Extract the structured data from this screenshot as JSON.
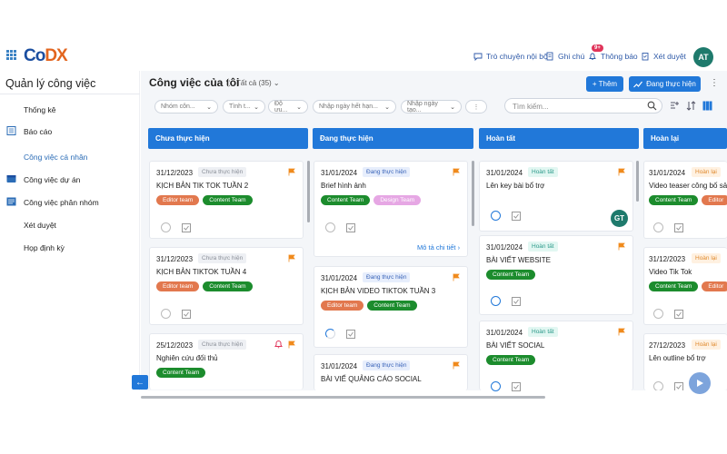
{
  "app": {
    "logo_part1": "Co",
    "logo_part2": "DX"
  },
  "topbar": {
    "chat_label": "Trò chuyện nội bộ",
    "notes_label": "Ghi chú",
    "notify_label": "Thông báo",
    "notify_badge": "9+",
    "approve_label": "Xét duyệt",
    "avatar_initials": "AT"
  },
  "sidebar": {
    "title": "Quản lý công việc",
    "items": [
      {
        "label": "Thống kê",
        "active": false,
        "icon": "none"
      },
      {
        "label": "Báo cáo",
        "active": false,
        "icon": "report-icon"
      },
      {
        "label": "Công việc cá nhân",
        "active": true,
        "icon": "none"
      },
      {
        "label": "Công việc dự án",
        "active": false,
        "icon": "project-icon"
      },
      {
        "label": "Công việc phân nhóm",
        "active": false,
        "icon": "group-icon"
      },
      {
        "label": "Xét duyệt",
        "active": false,
        "icon": "none"
      },
      {
        "label": "Họp định kỳ",
        "active": false,
        "icon": "none"
      }
    ]
  },
  "header": {
    "title": "Công việc của tôi",
    "filter_all": "Tất cả (35)",
    "add_button": "+ Thêm",
    "status_button": "Đang thực hiện",
    "kebab": "⋮"
  },
  "filters": {
    "pills": [
      "Nhóm côn...",
      "Tình t...",
      "Độ ưu...",
      "Nhập ngày hết hạn...",
      "Nhập ngày tạo..."
    ],
    "more": "⋮",
    "search_placeholder": "Tìm kiếm..."
  },
  "columns": [
    {
      "title": "Chưa thực hiện"
    },
    {
      "title": "Đang thực hiện"
    },
    {
      "title": "Hoàn tất"
    },
    {
      "title": "Hoàn lại"
    }
  ],
  "cards": {
    "c1": {
      "date": "31/12/2023",
      "status": "Chưa thực hiện",
      "title": "KỊCH BẢN TIK TOK TUẦN 2",
      "tags": [
        "Editor team",
        "Content Team"
      ]
    },
    "c2": {
      "date": "31/12/2023",
      "status": "Chưa thực hiện",
      "title": "KỊCH BẢN TIKTOK TUẦN 4",
      "tags": [
        "Editor team",
        "Content Team"
      ]
    },
    "c3": {
      "date": "25/12/2023",
      "status": "Chưa thực hiện",
      "title": "Nghiên cứu đối thủ",
      "tags": [
        "Content Team"
      ]
    },
    "d1": {
      "date": "31/01/2024",
      "status": "Đang thực hiện",
      "title": "Brief hình ảnh",
      "tags": [
        "Content Team",
        "Design Team"
      ],
      "more": "Mô tả chi tiết ›"
    },
    "d2": {
      "date": "31/01/2024",
      "status": "Đang thực hiện",
      "title": "KỊCH BẢN VIDEO TIKTOK TUẦN 3",
      "tags": [
        "Editor team",
        "Content Team"
      ]
    },
    "d3": {
      "date": "31/01/2024",
      "status": "Đang thực hiện",
      "title": "BÀI VIẾ QUẢNG CÁO SOCIAL"
    },
    "e1": {
      "date": "31/01/2024",
      "status": "Hoàn tất",
      "title": "Lên key bài bổ trợ",
      "assignee": "GT"
    },
    "e2": {
      "date": "31/01/2024",
      "status": "Hoàn tất",
      "title": "BÀI VIẾT WEBSITE",
      "tags": [
        "Content Team"
      ]
    },
    "e3": {
      "date": "31/01/2024",
      "status": "Hoàn tất",
      "title": "BÀI VIẾT SOCIAL",
      "tags": [
        "Content Team"
      ]
    },
    "f1": {
      "date": "31/01/2024",
      "status": "Hoàn lại",
      "title": "Video teaser công bố sả",
      "tags": [
        "Content Team",
        "Editor"
      ]
    },
    "f2": {
      "date": "31/12/2023",
      "status": "Hoàn lại",
      "title": "Video Tik Tok",
      "tags": [
        "Content Team",
        "Editor"
      ]
    },
    "f3": {
      "date": "27/12/2023",
      "status": "Hoàn lại",
      "title": "Lên outline bổ trợ"
    }
  },
  "colors": {
    "accent": "#2178d9",
    "editor_tag": "#e2784e",
    "content_tag": "#1c8c2d",
    "design_tag": "#e6a7e4",
    "flag": "#f08a1c"
  }
}
